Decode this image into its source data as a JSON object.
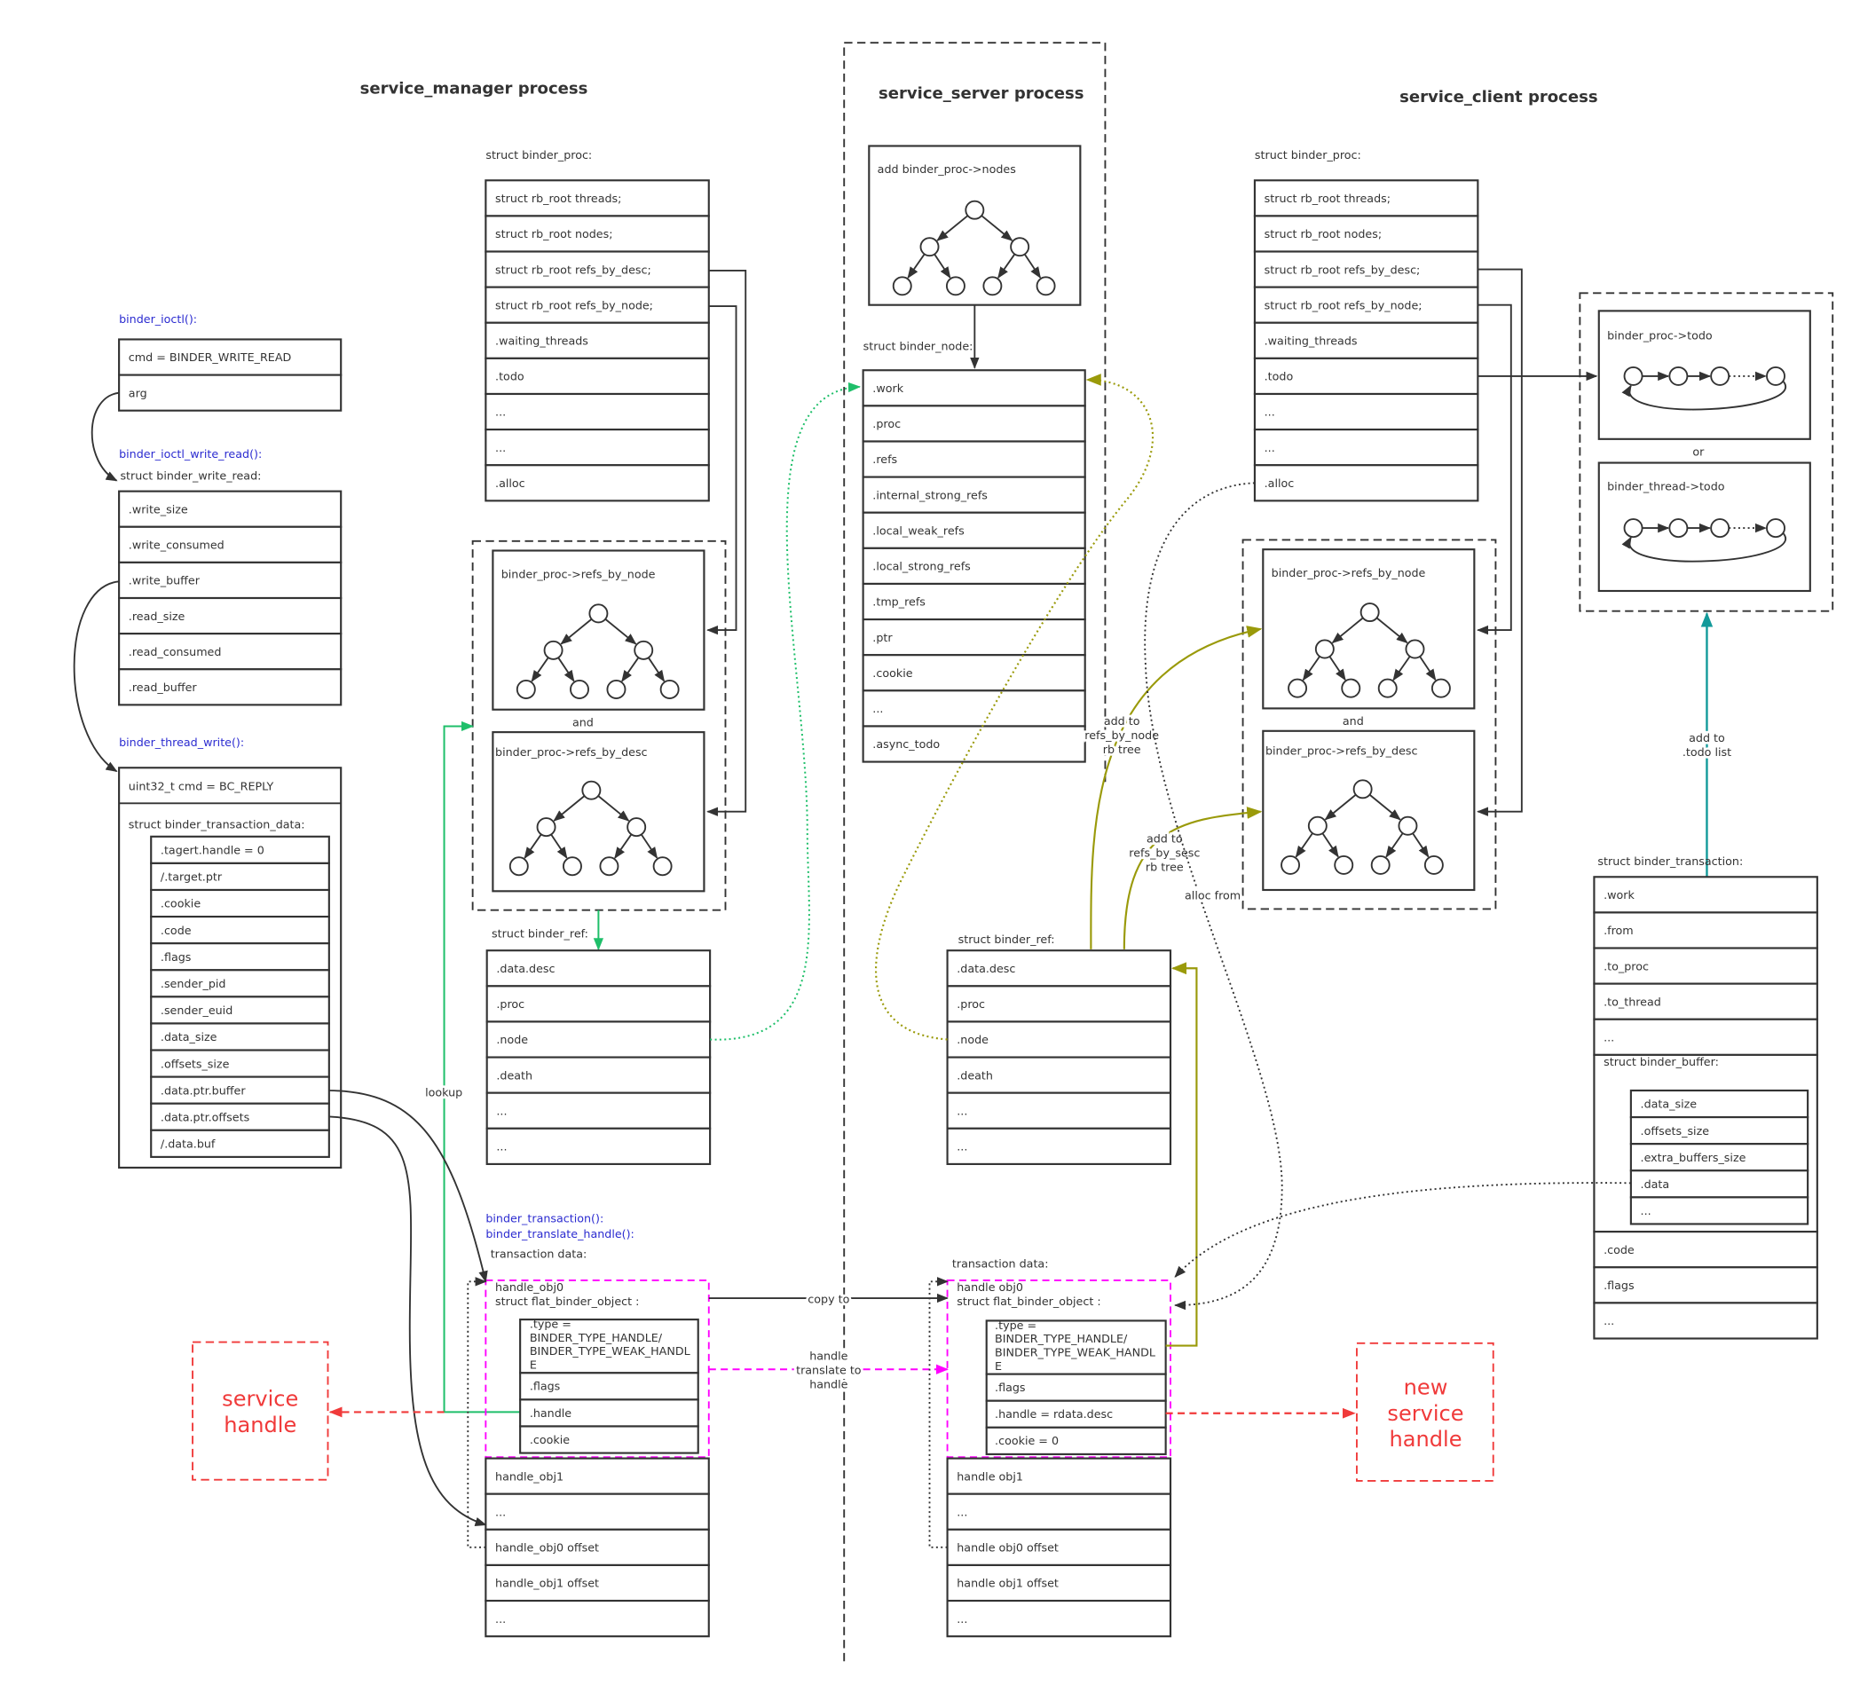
{
  "colors": {
    "text": "#333333",
    "function_label": "#2b2bd0",
    "handle_highlight": "#f03a3a",
    "flat_binder_object_outline": "#ff00ff",
    "lookup_arrow": "#1fbf6a",
    "ref_arrows": "#9a9a0a",
    "todo_arrow": "#139a9a"
  },
  "process_titles": {
    "manager": "service_manager process",
    "server": "service_server process",
    "client": "service_client process"
  },
  "ioctl": {
    "func": "binder_ioctl():",
    "rows": [
      "cmd = BINDER_WRITE_READ",
      "arg"
    ]
  },
  "write_read": {
    "func": "binder_ioctl_write_read():",
    "label": "struct binder_write_read:",
    "rows": [
      ".write_size",
      ".write_consumed",
      ".write_buffer",
      ".read_size",
      ".read_consumed",
      ".read_buffer"
    ]
  },
  "thread_write": {
    "func": "binder_thread_write():",
    "cmd": "uint32_t cmd = BC_REPLY",
    "label": "struct binder_transaction_data:",
    "rows": [
      ".tagert.handle = 0",
      "/.target.ptr",
      ".cookie",
      ".code",
      ".flags",
      ".sender_pid",
      ".sender_euid",
      ".data_size",
      ".offsets_size",
      ".data.ptr.buffer",
      ".data.ptr.offsets",
      "/.data.buf"
    ]
  },
  "manager_proc": {
    "label": "struct binder_proc:",
    "rows": [
      "struct rb_root threads;",
      "struct rb_root nodes;",
      "struct rb_root refs_by_desc;",
      "struct rb_root refs_by_node;",
      ".waiting_threads",
      ".todo",
      "...",
      "...",
      ".alloc"
    ],
    "tree_by_node": "binder_proc->refs_by_node",
    "and": "and",
    "tree_by_desc": "binder_proc->refs_by_desc"
  },
  "manager_ref": {
    "label": "struct binder_ref:",
    "rows": [
      ".data.desc",
      ".proc",
      ".node",
      ".death",
      "...",
      "..."
    ]
  },
  "lookup_label": "lookup",
  "manager_txn": {
    "func1": "binder_transaction():",
    "func2": "binder_translate_handle():",
    "label": "transaction data:",
    "obj_title1": "handle_obj0",
    "obj_title2": "struct flat_binder_object :",
    "fields": [
      ".type =\nBINDER_TYPE_HANDLE/\nBINDER_TYPE_WEAK_HANDL\nE",
      ".flags",
      ".handle",
      ".cookie"
    ],
    "type_lines": [
      ".type =",
      "BINDER_TYPE_HANDLE/",
      "BINDER_TYPE_WEAK_HANDL",
      "E"
    ],
    "rows": [
      "handle_obj1",
      "...",
      "handle_obj0 offset",
      "handle_obj1 offset",
      "..."
    ]
  },
  "service_handle": [
    "service",
    "handle"
  ],
  "server": {
    "tree_label": "add binder_proc->nodes",
    "node_label": "struct binder_node:",
    "node_rows": [
      ".work",
      ".proc",
      ".refs",
      ".internal_strong_refs",
      ".local_weak_refs",
      ".local_strong_refs",
      ".tmp_refs",
      ".ptr",
      ".cookie",
      "...",
      ".async_todo"
    ],
    "copy_to": "copy to",
    "translate": [
      "handle",
      "translate to",
      "handle"
    ]
  },
  "client_ref": {
    "label": "struct binder_ref:",
    "rows": [
      ".data.desc",
      ".proc",
      ".node",
      ".death",
      "...",
      "..."
    ],
    "add_node": [
      "add to",
      "refs_by_node",
      "rb tree"
    ],
    "add_desc": [
      "add to",
      "refs_by_sesc",
      "rb tree"
    ],
    "alloc_from": "alloc from"
  },
  "client_txn": {
    "label": "transaction data:",
    "obj_title1": "handle obj0",
    "obj_title2": "struct flat_binder_object :",
    "type_lines": [
      ".type =",
      "BINDER_TYPE_HANDLE/",
      "BINDER_TYPE_WEAK_HANDL",
      "E"
    ],
    "fields": [
      ".flags",
      ".handle = rdata.desc",
      ".cookie = 0"
    ],
    "rows": [
      "handle obj1",
      "...",
      "handle obj0 offset",
      "handle obj1 offset",
      "..."
    ]
  },
  "new_service_handle": [
    "new",
    "service",
    "handle"
  ],
  "client_proc": {
    "label": "struct binder_proc:",
    "rows": [
      "struct rb_root threads;",
      "struct rb_root nodes;",
      "struct rb_root refs_by_desc;",
      "struct rb_root refs_by_node;",
      ".waiting_threads",
      ".todo",
      "...",
      "...",
      ".alloc"
    ],
    "tree_by_node": "binder_proc->refs_by_node",
    "and": "and",
    "tree_by_desc": "binder_proc->refs_by_desc"
  },
  "todo": {
    "proc_todo": "binder_proc->todo",
    "or": "or",
    "thread_todo": "binder_thread->todo",
    "add_label": [
      "add to",
      ".todo list"
    ]
  },
  "client_transaction": {
    "label": "struct binder_transaction:",
    "rows_top": [
      ".work",
      ".from",
      ".to_proc",
      ".to_thread",
      "..."
    ],
    "buffer_label": "struct binder_buffer:",
    "buffer_rows": [
      ".data_size",
      ".offsets_size",
      ".extra_buffers_size",
      ".data",
      "..."
    ],
    "rows_bottom": [
      ".code",
      ".flags",
      "..."
    ]
  }
}
